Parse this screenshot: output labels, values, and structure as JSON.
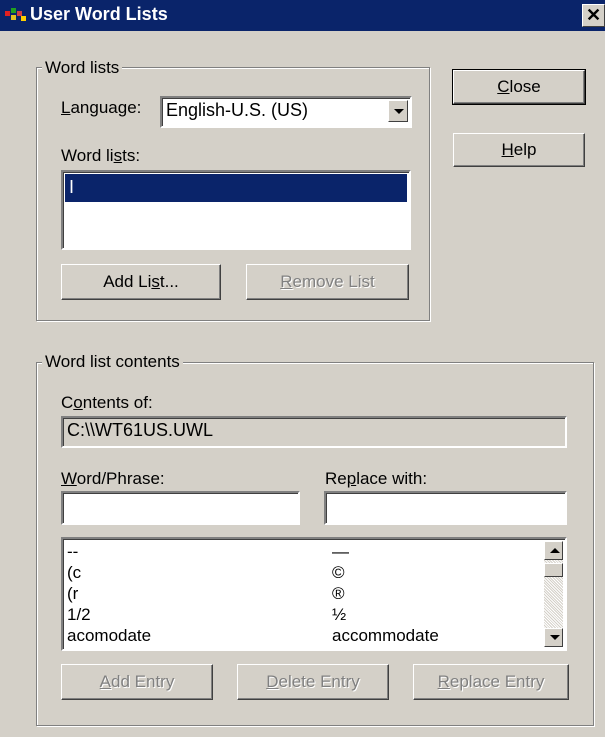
{
  "window": {
    "title": "User Word Lists",
    "close_glyph": "✕"
  },
  "word_lists_group": {
    "label": "Word lists",
    "language_label": "Language:",
    "language_value": "English-U.S.  (US)",
    "lists_label": "Word lists:",
    "lists": [
      "I"
    ],
    "add_list": "Add List...",
    "remove_list": "Remove List"
  },
  "side_buttons": {
    "close": "Close",
    "help": "Help"
  },
  "contents_group": {
    "label": "Word list contents",
    "contents_of_label": "Contents of:",
    "contents_of_value": "C:\\\\WT61US.UWL",
    "word_phrase_label": "Word/Phrase:",
    "word_phrase_value": "",
    "replace_with_label": "Replace with:",
    "replace_with_value": "",
    "entries": [
      {
        "word": "--",
        "replacement": "—"
      },
      {
        "word": "(c",
        "replacement": "©"
      },
      {
        "word": "(r",
        "replacement": "®"
      },
      {
        "word": "1/2",
        "replacement": "½"
      },
      {
        "word": "acomodate",
        "replacement": "accommodate"
      }
    ],
    "add_entry": "Add Entry",
    "delete_entry": "Delete Entry",
    "replace_entry": "Replace Entry"
  },
  "colors": {
    "titlebar": "#0a246a",
    "face": "#d4d0c8",
    "selection": "#0a246a"
  }
}
